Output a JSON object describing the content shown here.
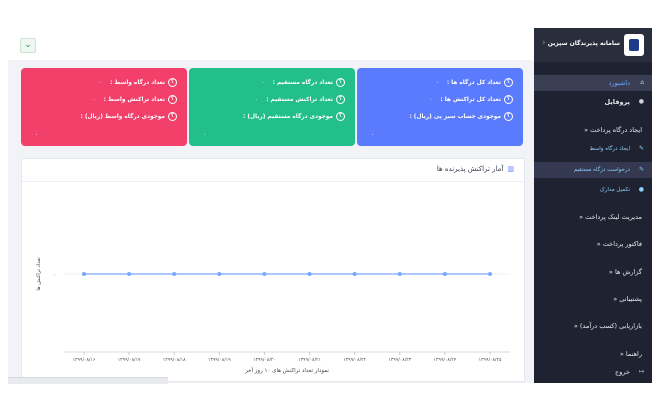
{
  "sidebar": {
    "title": "سامانه پذیرندگان سپزین",
    "items": [
      {
        "label": "داشبورد",
        "icon": "home-icon"
      },
      {
        "label": "پروفایل",
        "icon": "user-icon"
      },
      {
        "label": "ایجاد درگاه پرداخت «"
      },
      {
        "label": "ایجاد درگاه واسط",
        "icon": "plug-icon"
      },
      {
        "label": "درخواست درگاه مستقیم",
        "icon": "pencil-icon"
      },
      {
        "label": "تکمیل مدارک",
        "icon": "user-icon"
      },
      {
        "label": "مدیریت لینک پرداخت «"
      },
      {
        "label": "فاکتور پرداخت «"
      },
      {
        "label": "گزارش ها «"
      },
      {
        "label": "پشتیبانی «"
      },
      {
        "label": "بازاریابی (کسب درآمد) «"
      },
      {
        "label": "راهنما «"
      },
      {
        "label": "خروج",
        "icon": "logout-icon"
      }
    ]
  },
  "cards": {
    "blue": {
      "lines": [
        {
          "label": "تعداد کل درگاه ها :",
          "value": "۰"
        },
        {
          "label": "تعداد کل تراکنش ها :",
          "value": "۰"
        },
        {
          "label": "موجودی حساب سبز پی (ریال) :",
          "value": ""
        }
      ],
      "footer": "۰"
    },
    "green": {
      "lines": [
        {
          "label": "تعداد درگاه مستقیم :",
          "value": "۰"
        },
        {
          "label": "تعداد تراکنش مستقیم :",
          "value": "۰"
        },
        {
          "label": "موجودی درگاه مستقیم (ریال) :",
          "value": ""
        }
      ],
      "footer": "۰"
    },
    "red": {
      "lines": [
        {
          "label": "تعداد درگاه واسط :",
          "value": "۰"
        },
        {
          "label": "تعداد تراکنش واسط :",
          "value": "۰"
        },
        {
          "label": "موجودی درگاه واسط (ریال) :",
          "value": ""
        }
      ],
      "footer": "۰"
    }
  },
  "panel": {
    "title": "آمار تراکنش پذیرنده ها"
  },
  "chart_data": {
    "type": "line",
    "categories": [
      "۱۳۹۹/۰۸/۱۶",
      "۱۳۹۹/۰۸/۱۷",
      "۱۳۹۹/۰۸/۱۸",
      "۱۳۹۹/۰۸/۱۹",
      "۱۳۹۹/۰۸/۲۰",
      "۱۳۹۹/۰۸/۲۱",
      "۱۳۹۹/۰۸/۲۲",
      "۱۳۹۹/۰۸/۲۳",
      "۱۳۹۹/۰۸/۲۴",
      "۱۳۹۹/۰۸/۲۵"
    ],
    "series": [
      {
        "values": [
          0,
          0,
          0,
          0,
          0,
          0,
          0,
          0,
          0,
          0
        ]
      }
    ],
    "ylabel": "تعداد تراکنش ها",
    "xlabel": "نمودار تعداد تراکنش های ۱۰ روز آخر",
    "yticks": [
      "۰"
    ],
    "color": "#7aa7ff"
  }
}
